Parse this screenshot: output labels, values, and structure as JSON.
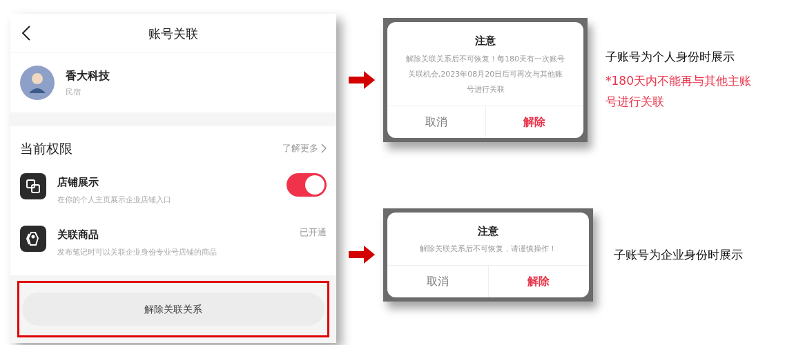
{
  "screen": {
    "title": "账号关联",
    "account": {
      "name": "香大科技",
      "category": "民宿"
    },
    "section": {
      "title": "当前权限",
      "link": "了解更多"
    },
    "permissions": [
      {
        "kind": "toggle",
        "title": "店铺展示",
        "description": "在你的个人主页展示企业店铺入口",
        "on": true
      },
      {
        "kind": "status",
        "title": "关联商品",
        "description": "发布笔记时可以关联企业身份专业号店铺的商品",
        "status": "已开通"
      }
    ],
    "unlink_button": "解除关联关系",
    "highlighted": true
  },
  "examples": [
    {
      "dialog": {
        "title": "注意",
        "message": "解除关联关系后不可恢复！每180天有一次账号关联机会,2023年08月20日后可再次与其他账号进行关联",
        "buttons": [
          {
            "label": "取消",
            "kind": "cancel"
          },
          {
            "label": "解除",
            "kind": "destructive"
          }
        ]
      },
      "note": "子账号为个人身份时展示",
      "warning": "*180天内不能再与其他主账号进行关联"
    },
    {
      "dialog": {
        "title": "注意",
        "message": "解除关联关系后不可恢复，请谨慎操作！",
        "buttons": [
          {
            "label": "取消",
            "kind": "cancel"
          },
          {
            "label": "解除",
            "kind": "destructive"
          }
        ]
      },
      "note": "子账号为企业身份时展示"
    }
  ]
}
